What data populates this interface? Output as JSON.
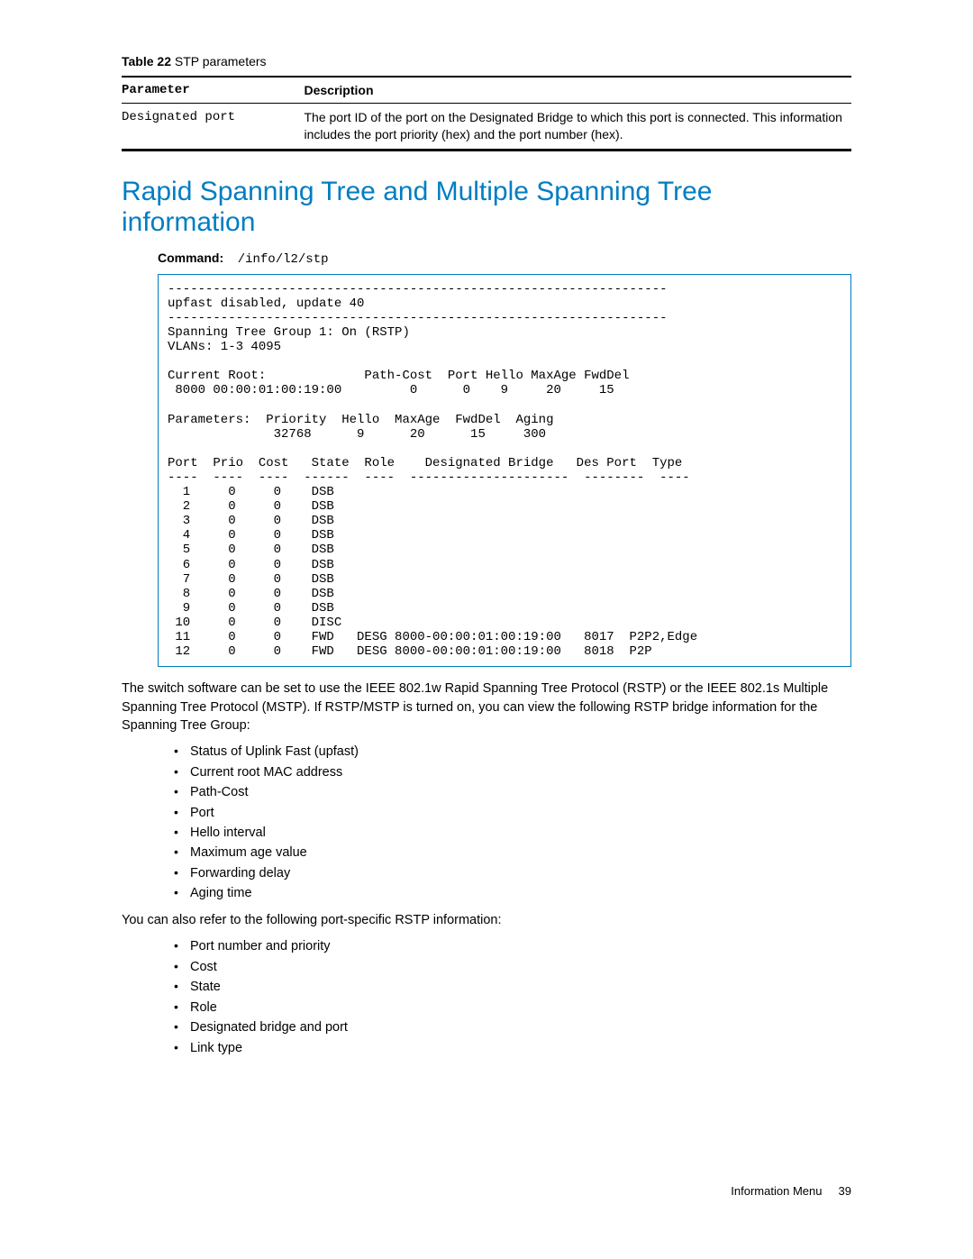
{
  "table_caption_label": "Table 22",
  "table_caption_text": "  STP parameters",
  "table": {
    "headers": {
      "param": "Parameter",
      "desc": "Description"
    },
    "rows": [
      {
        "param": "Designated port",
        "desc": "The port ID of the port on the Designated Bridge to which this port is connected. This information includes the port priority (hex) and the port number (hex)."
      }
    ]
  },
  "section_heading": "Rapid Spanning Tree and Multiple Spanning Tree information",
  "command_label": "Command:",
  "command_value": "/info/l2/stp",
  "cli_output": "------------------------------------------------------------------\nupfast disabled, update 40\n------------------------------------------------------------------\nSpanning Tree Group 1: On (RSTP)\nVLANs: 1-3 4095\n\nCurrent Root:             Path-Cost  Port Hello MaxAge FwdDel\n 8000 00:00:01:00:19:00         0      0    9     20     15\n\nParameters:  Priority  Hello  MaxAge  FwdDel  Aging\n              32768      9      20      15     300\n\nPort  Prio  Cost   State  Role    Designated Bridge   Des Port  Type\n----  ----  ----  ------  ----  ---------------------  --------  ----\n  1     0     0    DSB\n  2     0     0    DSB\n  3     0     0    DSB\n  4     0     0    DSB\n  5     0     0    DSB\n  6     0     0    DSB\n  7     0     0    DSB\n  8     0     0    DSB\n  9     0     0    DSB\n 10     0     0    DISC\n 11     0     0    FWD   DESG 8000-00:00:01:00:19:00   8017  P2P2,Edge\n 12     0     0    FWD   DESG 8000-00:00:01:00:19:00   8018  P2P",
  "para1": "The switch software can be set to use the IEEE 802.1w Rapid Spanning Tree Protocol (RSTP) or the IEEE 802.1s Multiple Spanning Tree Protocol (MSTP). If RSTP/MSTP is turned on, you can view the following RSTP bridge information for the Spanning Tree Group:",
  "bullets1": [
    "Status of Uplink Fast (upfast)",
    "Current root MAC address",
    "Path-Cost",
    "Port",
    "Hello interval",
    "Maximum age value",
    "Forwarding delay",
    "Aging time"
  ],
  "para2": "You can also refer to the following port-specific RSTP information:",
  "bullets2": [
    "Port number and priority",
    "Cost",
    "State",
    "Role",
    "Designated bridge and port",
    "Link type"
  ],
  "footer_section": "Information Menu",
  "footer_page": "39"
}
